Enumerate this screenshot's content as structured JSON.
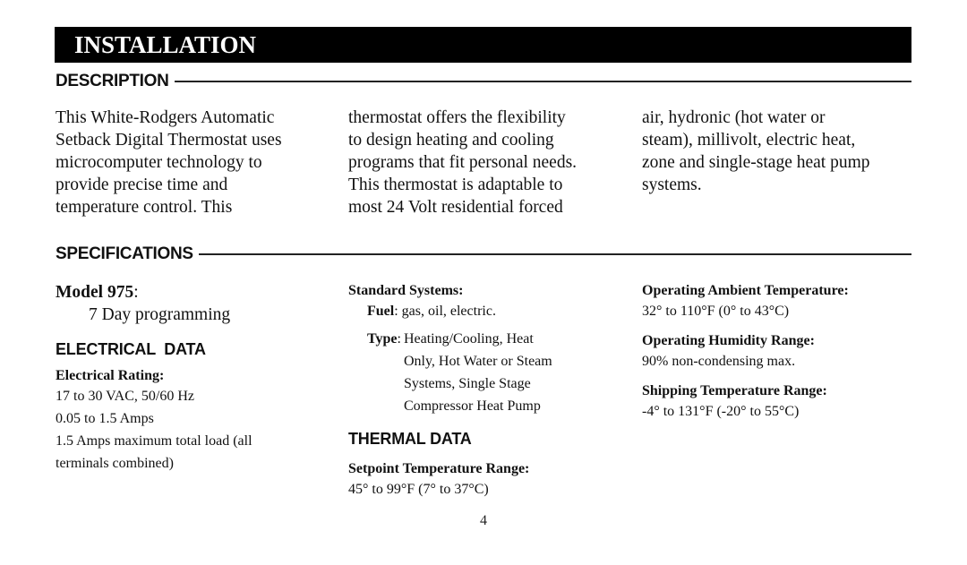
{
  "page": {
    "title": "INSTALLATION",
    "page_number": "4"
  },
  "description": {
    "heading": "DESCRIPTION",
    "columns": [
      [
        "This White-Rodgers Automatic",
        "Setback Digital Thermostat uses",
        "microcomputer technology to",
        "provide precise time and",
        "temperature control. This"
      ],
      [
        "thermostat offers the flexibility",
        "to design heating and cooling",
        "programs that fit personal needs.",
        "This thermostat is adaptable to",
        "most 24 Volt residential forced"
      ],
      [
        "air, hydronic (hot water or",
        "steam), millivolt, electric heat,",
        "zone and single-stage heat pump",
        "systems."
      ]
    ]
  },
  "specifications": {
    "heading": "SPECIFICATIONS",
    "model": {
      "label": "Model 975",
      "suffix": ":",
      "value": "7 Day programming"
    },
    "electrical": {
      "heading": "ELECTRICAL  DATA",
      "rating_label": "Electrical Rating:",
      "lines": [
        "17 to 30 VAC, 50/60 Hz",
        "0.05 to 1.5 Amps",
        "1.5 Amps maximum total load (all",
        "terminals combined)"
      ]
    },
    "standard_systems": {
      "label": "Standard Systems:",
      "fuel_label": "Fuel",
      "fuel_value": ": gas, oil, electric.",
      "type_label": "Type",
      "type_colon": ":",
      "type_lines": [
        "Heating/Cooling, Heat",
        "Only, Hot Water or Steam",
        "Systems, Single Stage",
        "Compressor Heat Pump"
      ]
    },
    "thermal": {
      "heading": "THERMAL DATA",
      "setpoint_label": "Setpoint Temperature Range:",
      "setpoint_value": "45° to 99°F (7° to 37°C)"
    },
    "operating": {
      "ambient_label": "Operating Ambient Temperature:",
      "ambient_value": "32° to 110°F (0° to 43°C)",
      "humidity_label": "Operating Humidity Range:",
      "humidity_value": "90% non-condensing max.",
      "shipping_label": "Shipping Temperature Range:",
      "shipping_value": "-4° to 131°F (-20° to 55°C)"
    }
  }
}
